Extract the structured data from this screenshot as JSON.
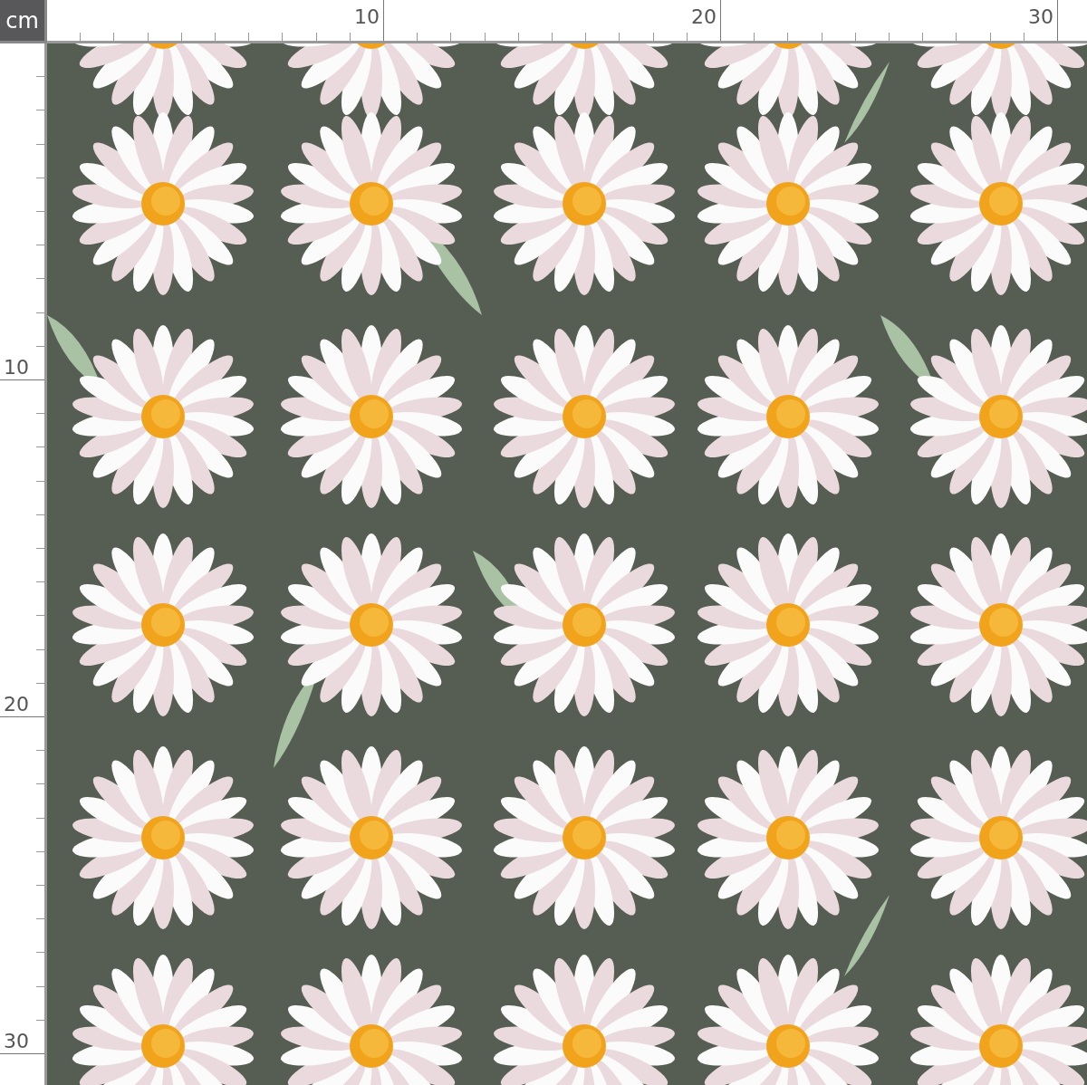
{
  "unit_badge": "cm",
  "top_ruler": {
    "labels": [
      "10",
      "20",
      "30"
    ]
  },
  "left_ruler": {
    "labels": [
      "10",
      "20",
      "30"
    ]
  }
}
